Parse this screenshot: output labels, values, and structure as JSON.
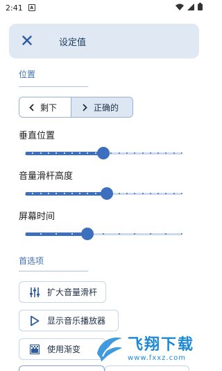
{
  "status_bar": {
    "time": "2:41",
    "notification_icon": "notification-a-icon",
    "icons": [
      "wifi-icon",
      "signal-icon",
      "battery-icon"
    ]
  },
  "header": {
    "close_icon": "close-icon",
    "title": "设定值"
  },
  "position_section": {
    "title": "位置",
    "toggle": {
      "left_label": "剩下",
      "right_label": "正确的",
      "selected": "right"
    }
  },
  "sliders": [
    {
      "label": "垂直位置",
      "value": 0.5,
      "ticks": 21
    },
    {
      "label": "音量滑杆高度",
      "value": 0.52,
      "ticks": 21
    },
    {
      "label": "屏幕时间",
      "value": 0.4,
      "ticks": 11
    }
  ],
  "preferences_section": {
    "title": "首选项",
    "buttons": [
      {
        "label": "扩大音量滑杆",
        "icon": "sliders-icon"
      },
      {
        "label": "显示音乐播放器",
        "icon": "play-icon"
      },
      {
        "label": "使用渐变",
        "icon": "gradient-icon"
      }
    ]
  },
  "watermark": {
    "brand": "飞翔下载",
    "url": "www.fxxz.com"
  },
  "colors": {
    "accent": "#3c6fbd",
    "header_bg": "#dfe8f3",
    "selected_bg": "#dde7f4",
    "section_title": "#3f72b8",
    "watermark": "#1e88d8"
  }
}
